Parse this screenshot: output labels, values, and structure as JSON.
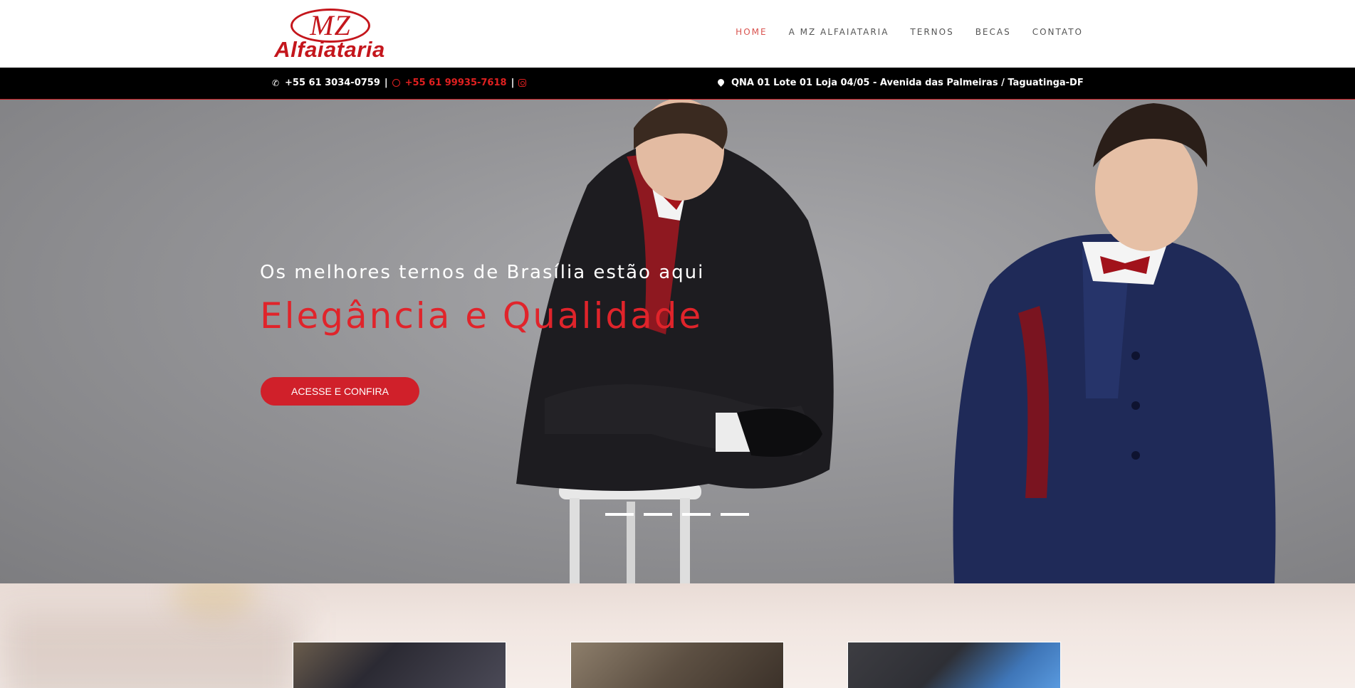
{
  "header": {
    "logo": {
      "monogram": "MZ",
      "name": "Alfaiataria"
    },
    "nav": [
      {
        "label": "HOME",
        "active": true
      },
      {
        "label": "A MZ ALFAIATARIA",
        "active": false
      },
      {
        "label": "TERNOS",
        "active": false
      },
      {
        "label": "BECAS",
        "active": false
      },
      {
        "label": "CONTATO",
        "active": false
      }
    ]
  },
  "infobar": {
    "phone": "+55 61 3034-0759",
    "separator": "|",
    "whatsapp": "+55 61 99935-7618",
    "address": "QNA 01 Lote 01 Loja 04/05 - Avenida das Palmeiras / Taguatinga-DF"
  },
  "hero": {
    "subtitle": "Os melhores ternos de Brasília estão aqui",
    "title": "Elegância e Qualidade",
    "button_label": "ACESSE E CONFIRA",
    "slides": 4
  },
  "colors": {
    "brand_red": "#c4161c",
    "accent_red": "#d0202a",
    "nav_active": "#d9534f",
    "bar_bg": "#000000"
  },
  "icons": [
    "phone-icon",
    "whatsapp-icon",
    "instagram-icon",
    "map-pin-icon"
  ]
}
